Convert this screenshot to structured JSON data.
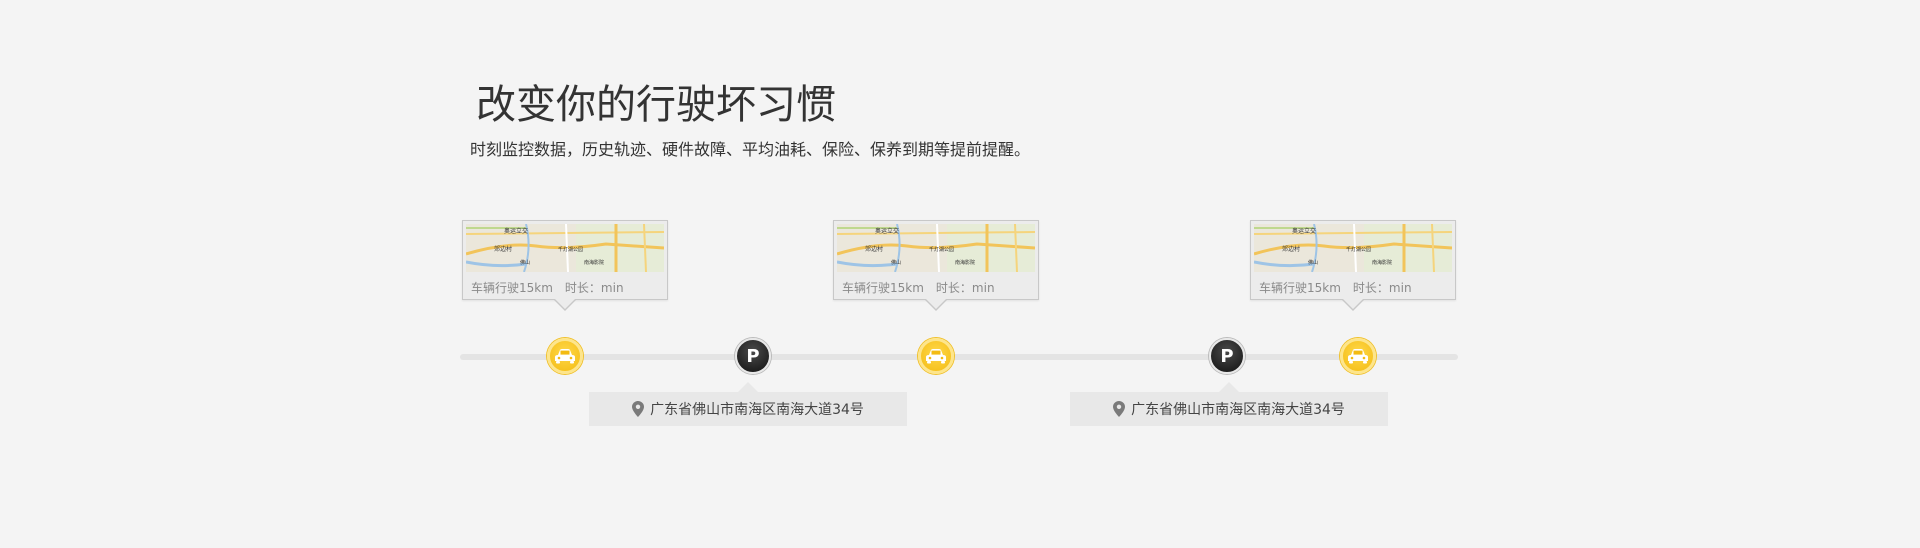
{
  "header": {
    "title": "改变你的行驶坏习惯",
    "subtitle": "时刻监控数据，历史轨迹、硬件故障、平均油耗、保险、保养到期等提前提醒。"
  },
  "trips": [
    {
      "distance": "车辆行驶15km",
      "duration": "时长：min"
    },
    {
      "distance": "车辆行驶15km",
      "duration": "时长：min"
    },
    {
      "distance": "车辆行驶15km",
      "duration": "时长：min"
    }
  ],
  "parking": [
    {
      "marker_label": "P",
      "address": "广东省佛山市南海区南海大道34号"
    },
    {
      "marker_label": "P",
      "address": "广东省佛山市南海区南海大道34号"
    }
  ],
  "map_labels": [
    "奥运立交",
    "郊边村",
    "千灯湖公园",
    "南海影院",
    "佛山"
  ],
  "icons": {
    "car": "car-icon",
    "parking": "parking-icon",
    "location": "location-pin-icon"
  },
  "colors": {
    "background": "#f4f4f4",
    "car_marker": "#f3bb12",
    "parking_marker": "#111111",
    "track": "#e4e4e4"
  }
}
